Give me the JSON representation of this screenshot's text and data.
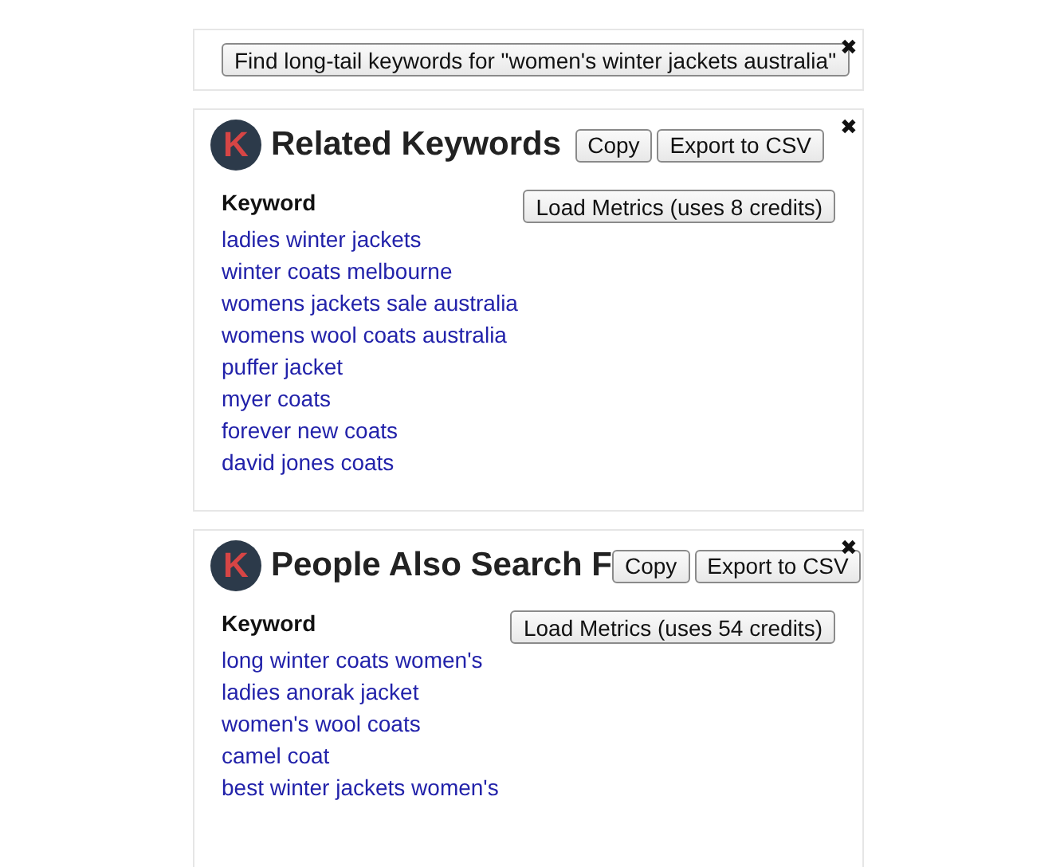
{
  "search_panel": {
    "button": "Find long-tail keywords for \"women's winter jackets australia\"",
    "close": "✖"
  },
  "panels": [
    {
      "logo": "K",
      "title": "Related Keywords",
      "copy": "Copy",
      "export": "Export to CSV",
      "close": "✖",
      "column": "Keyword",
      "load": "Load Metrics (uses 8 credits)",
      "keywords": [
        "ladies winter jackets",
        "winter coats melbourne",
        "womens jackets sale australia",
        "womens wool coats australia",
        "puffer jacket",
        "myer coats",
        "forever new coats",
        "david jones coats"
      ]
    },
    {
      "logo": "K",
      "title": "People Also Search F",
      "copy": "Copy",
      "export": "Export to CSV",
      "close": "✖",
      "column": "Keyword",
      "load": "Load Metrics (uses 54 credits)",
      "keywords": [
        "long winter coats women's",
        "ladies anorak jacket",
        "women's wool coats",
        "camel coat",
        "best winter jackets women's"
      ]
    }
  ]
}
